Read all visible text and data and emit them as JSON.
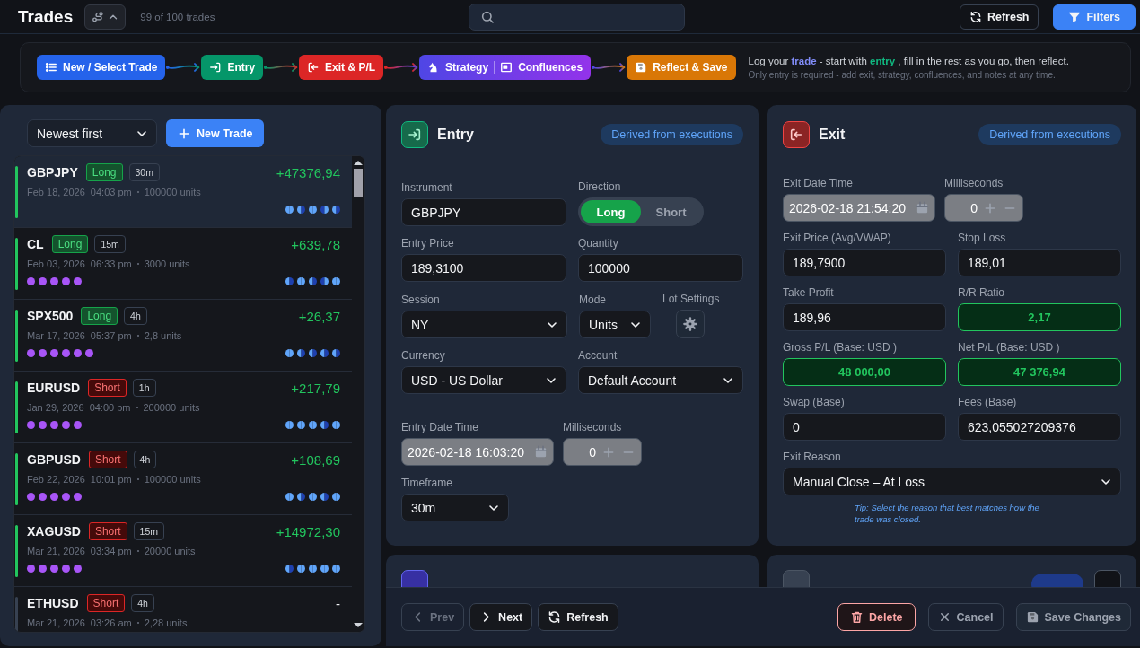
{
  "header": {
    "title": "Trades",
    "count": "99 of 100 trades",
    "buttons": [
      {
        "label": "Refresh",
        "kind": "refresh"
      },
      {
        "label": "Filters",
        "kind": "filter"
      }
    ]
  },
  "workflow": {
    "steps": [
      {
        "kind": "list",
        "label": "New / Select Trade",
        "color": "#2563eb"
      },
      {
        "kind": "entry",
        "label": "Entry",
        "color": "#059669"
      },
      {
        "kind": "exit",
        "label": "Exit & P/L",
        "color": "#dc2626"
      },
      {
        "kind": "split",
        "color": "#4f46e5",
        "parts": [
          {
            "kind": "strategy",
            "label": "Strategy"
          },
          {
            "kind": "confluences",
            "label": "Confluences"
          }
        ]
      },
      {
        "kind": "save",
        "label": "Reflect & Save",
        "color": "#d97706"
      }
    ],
    "hint": [
      {
        "text": "Log your ",
        "kind": "plain"
      },
      {
        "text": "trade",
        "kind": "accent"
      },
      {
        "text": " - start with ",
        "kind": "plain"
      },
      {
        "text": "entry",
        "kind": "success"
      },
      {
        "text": " , fill in the rest as you go, then reflect.",
        "kind": "plain"
      }
    ],
    "note": "Only entry is required - add exit, strategy, confluences, and notes at any time."
  },
  "trade_list": {
    "sort": "Newest first",
    "new_button": "New Trade",
    "trades": [
      {
        "symbol": "GBPJPY",
        "direction": "Long",
        "timeframe": "30m",
        "pnl": "+47376,94",
        "closed": true,
        "date": "Feb 18, 2026",
        "time": "04:03 pm",
        "units": "100000 units",
        "stars": 0,
        "moons": [
          {
            "kind": "full"
          },
          {
            "kind": "half"
          },
          {
            "kind": "full"
          },
          {
            "kind": "dark"
          },
          {
            "kind": "half"
          }
        ],
        "selected": true
      },
      {
        "symbol": "CL",
        "direction": "Long",
        "timeframe": "15m",
        "pnl": "+639,78",
        "closed": true,
        "date": "Feb 03, 2026",
        "time": "06:33 pm",
        "units": "3000 units",
        "stars": 5,
        "moons": [
          {
            "kind": "half"
          },
          {
            "kind": "full"
          },
          {
            "kind": "half"
          },
          {
            "kind": "dark"
          },
          {
            "kind": "full"
          }
        ],
        "selected": false
      },
      {
        "symbol": "SPX500",
        "direction": "Long",
        "timeframe": "4h",
        "pnl": "+26,37",
        "closed": true,
        "date": "Mar 17, 2026",
        "time": "05:37 pm",
        "units": "2,8 units",
        "stars": 6,
        "moons": [
          {
            "kind": "full"
          },
          {
            "kind": "half"
          },
          {
            "kind": "half"
          },
          {
            "kind": "half"
          },
          {
            "kind": "half"
          }
        ],
        "selected": false
      },
      {
        "symbol": "EURUSD",
        "direction": "Short",
        "timeframe": "1h",
        "pnl": "+217,79",
        "closed": true,
        "date": "Jan 29, 2026",
        "time": "04:00 pm",
        "units": "200000 units",
        "stars": 5,
        "moons": [
          {
            "kind": "full"
          },
          {
            "kind": "full"
          },
          {
            "kind": "full"
          },
          {
            "kind": "half"
          },
          {
            "kind": "full"
          }
        ],
        "selected": false
      },
      {
        "symbol": "GBPUSD",
        "direction": "Short",
        "timeframe": "4h",
        "pnl": "+108,69",
        "closed": true,
        "date": "Feb 22, 2026",
        "time": "10:01 pm",
        "units": "100000 units",
        "stars": 5,
        "moons": [
          {
            "kind": "full"
          },
          {
            "kind": "half"
          },
          {
            "kind": "full"
          },
          {
            "kind": "half"
          },
          {
            "kind": "full"
          }
        ],
        "selected": false
      },
      {
        "symbol": "XAGUSD",
        "direction": "Short",
        "timeframe": "15m",
        "pnl": "+14972,30",
        "closed": true,
        "date": "Mar 21, 2026",
        "time": "03:34 pm",
        "units": "20000 units",
        "stars": 5,
        "moons": [
          {
            "kind": "half"
          },
          {
            "kind": "full"
          },
          {
            "kind": "full"
          },
          {
            "kind": "full"
          },
          {
            "kind": "full"
          }
        ],
        "selected": false
      },
      {
        "symbol": "ETHUSD",
        "direction": "Short",
        "timeframe": "4h",
        "pnl": "-",
        "closed": false,
        "date": "Mar 21, 2026",
        "time": "03:26 am",
        "units": "2,28 units",
        "selected": false
      }
    ]
  },
  "entry": {
    "title": "Entry",
    "badge": "Derived from executions",
    "rows": [
      [
        {
          "kind": "text",
          "label": "Instrument",
          "value": "GBPJPY"
        },
        {
          "kind": "toggle",
          "label": "Direction",
          "options": [
            {
              "label": "Long",
              "selected": true
            },
            {
              "label": "Short",
              "selected": false
            }
          ]
        }
      ],
      [
        {
          "kind": "text",
          "label": "Entry Price",
          "value": "189,3100"
        },
        {
          "kind": "text",
          "label": "Quantity",
          "value": "100000"
        }
      ],
      [
        {
          "kind": "select",
          "label": "Session",
          "value": "NY"
        },
        {
          "kind": "select",
          "label": "Mode",
          "value": "Units"
        },
        {
          "kind": "gear",
          "label": "Lot Settings"
        }
      ],
      [
        {
          "kind": "select",
          "label": "Currency",
          "value": "USD - US Dollar"
        },
        {
          "kind": "select",
          "label": "Account",
          "value": "Default Account"
        }
      ],
      [
        {
          "kind": "date",
          "label": "Entry Date Time",
          "value": "2026-02-18 16:03:20",
          "disabled": true
        },
        {
          "kind": "ms",
          "label": "Milliseconds",
          "value": "0",
          "disabled": true
        }
      ],
      [
        {
          "kind": "select",
          "label": "Timeframe",
          "value": "30m"
        }
      ]
    ]
  },
  "exit": {
    "title": "Exit",
    "badge": "Derived from executions",
    "rows": [
      [
        {
          "kind": "date",
          "label": "Exit Date Time",
          "value": "2026-02-18 21:54:20",
          "disabled": true
        },
        {
          "kind": "ms",
          "label": "Milliseconds",
          "value": "0",
          "disabled": true
        }
      ],
      [
        {
          "kind": "text",
          "label": "Exit Price (Avg/VWAP)",
          "value": "189,7900"
        },
        {
          "kind": "text",
          "label": "Stop Loss",
          "value": "189,01"
        }
      ],
      [
        {
          "kind": "text",
          "label": "Take Profit",
          "value": "189,96"
        },
        {
          "kind": "result",
          "label": "R/R Ratio",
          "value": "2,17"
        }
      ],
      [
        {
          "kind": "result",
          "label": "Gross P/L (Base:  USD )",
          "value": "48 000,00"
        },
        {
          "kind": "result",
          "label": "Net P/L (Base:  USD )",
          "value": "47 376,94"
        }
      ],
      [
        {
          "kind": "text",
          "label": "Swap (Base)",
          "value": "0"
        },
        {
          "kind": "text",
          "label": "Fees (Base)",
          "value": "623,055027209376"
        }
      ],
      [
        {
          "kind": "select",
          "label": "Exit Reason",
          "value": "Manual Close – At Loss",
          "tip": "Tip: Select the reason that best matches how the trade was closed."
        }
      ]
    ]
  },
  "footer": {
    "left": [
      {
        "kind": "prev",
        "label": "Prev",
        "disabled": true
      },
      {
        "kind": "next",
        "label": "Next",
        "disabled": false
      },
      {
        "kind": "refresh",
        "label": "Refresh",
        "disabled": false
      }
    ],
    "right": [
      {
        "kind": "delete",
        "label": "Delete"
      },
      {
        "kind": "cancel",
        "label": "Cancel"
      },
      {
        "kind": "save",
        "label": "Save Changes",
        "disabled": true
      }
    ]
  }
}
